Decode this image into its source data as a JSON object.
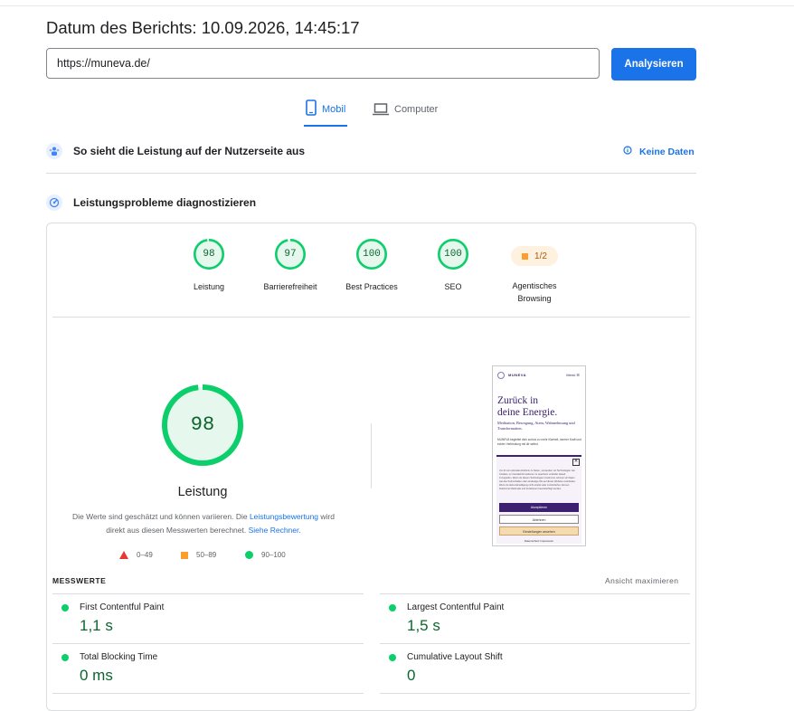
{
  "header": {
    "report_date": "Datum des Berichts: 10.09.2026, 14:45:17",
    "url_value": "https://muneva.de/",
    "analyze_label": "Analysieren"
  },
  "tabs": [
    {
      "label": "Mobil",
      "icon": "smartphone-icon",
      "active": true
    },
    {
      "label": "Computer",
      "icon": "laptop-icon",
      "active": false
    }
  ],
  "field_section": {
    "title": "So sieht die Leistung auf der Nutzerseite aus",
    "no_data_label": "Keine Daten"
  },
  "diagnose_section": {
    "title": "Leistungsprobleme diagnostizieren"
  },
  "scores": [
    {
      "value": "98",
      "label": "Leistung",
      "fraction": 0.98
    },
    {
      "value": "97",
      "label": "Barrierefreiheit",
      "fraction": 0.97
    },
    {
      "value": "100",
      "label": "Best Practices",
      "fraction": 1.0
    },
    {
      "value": "100",
      "label": "SEO",
      "fraction": 1.0
    }
  ],
  "agentic": {
    "value": "1/2",
    "label_line1": "Agentisches",
    "label_line2": "Browsing"
  },
  "performance": {
    "score": "98",
    "fraction": 0.98,
    "label": "Leistung",
    "note_part1": "Die Werte sind geschätzt und können variieren. Die ",
    "note_link1": "Leistungsbewertung",
    "note_part2": " wird direkt aus diesen Messwerten berechnet. ",
    "note_link2": "Siehe Rechner."
  },
  "legend": {
    "poor": "0–49",
    "average": "50–89",
    "good": "90–100"
  },
  "screenshot": {
    "brand": "MUNEVA",
    "menu": "Menü ☰",
    "headline_line1": "Zurück in",
    "headline_line2": "deine Energie.",
    "subline": "Meditation, Bewegung, Atem, Wahrnehmung und Transformation.",
    "text": "MUNEVA begleitet dich zurück zu mehr Klarheit, innerer Kraft und echter Verbindung mit dir selbst.",
    "dialog_text": "Um dir ein optimales Erlebnis zu bieten, verwenden wir Technologien wie Cookies, um Geräteinformationen zu speichern und/oder darauf zuzugreifen. Wenn du diesen Technologien zustimmst, können wir Daten wie das Surfverhalten oder eindeutige IDs auf dieser Website verarbeiten. Wenn du deine Einwilligung nicht erteilst oder zurückziehst, können bestimmte Merkmale und Funktionen beeinträchtigt werden.",
    "btn_accept": "Akzeptieren",
    "btn_reject": "Ablehnen",
    "btn_prefs": "Einstellungen ansehen",
    "links": "Datenschutz   Impressum"
  },
  "metrics_section": {
    "title": "MESSWERTE",
    "expand_label": "Ansicht maximieren",
    "items": [
      {
        "name": "First Contentful Paint",
        "value": "1,1 s"
      },
      {
        "name": "Largest Contentful Paint",
        "value": "1,5 s"
      },
      {
        "name": "Total Blocking Time",
        "value": "0 ms"
      },
      {
        "name": "Cumulative Layout Shift",
        "value": "0"
      }
    ]
  },
  "colors": {
    "accent": "#1a73e8",
    "good": "#0cce6b",
    "good_text": "#0d652d",
    "average": "#fa9f2e",
    "poor": "#e53935"
  }
}
